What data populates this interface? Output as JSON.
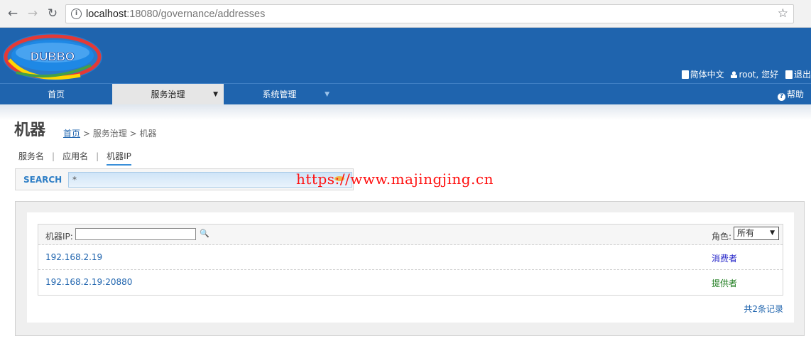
{
  "browser": {
    "url_host": "localhost",
    "url_path": ":18080/governance/addresses"
  },
  "header": {
    "logo_text": "DUBBO",
    "language_link": "简体中文",
    "user_greeting": "root, 您好",
    "logout_link": "退出"
  },
  "menu": {
    "home": "首页",
    "service_governance": "服务治理",
    "system_admin": "系统管理",
    "help": "帮助"
  },
  "page": {
    "title": "机器",
    "breadcrumb": {
      "home": "首页",
      "rest": " > 服务治理 > 机器"
    },
    "tabs": [
      {
        "label": "服务名"
      },
      {
        "label": "应用名"
      },
      {
        "label": "机器IP"
      }
    ],
    "search": {
      "label": "SEARCH",
      "value": "*"
    },
    "watermark": "https://www.majingjing.cn"
  },
  "table": {
    "filter_label": "机器IP:",
    "filter_value": "",
    "role_label": "角色:",
    "role_selected": "所有",
    "rows": [
      {
        "address": "192.168.2.19",
        "role": "消费者"
      },
      {
        "address": "192.168.2.19:20880",
        "role": "提供者"
      }
    ],
    "total": "共2条记录"
  },
  "colors": {
    "banner": "#1f64ae",
    "link": "#1f64ae",
    "consumer": "#2323c8",
    "provider": "#1a7a1a",
    "watermark": "#ff1010"
  }
}
